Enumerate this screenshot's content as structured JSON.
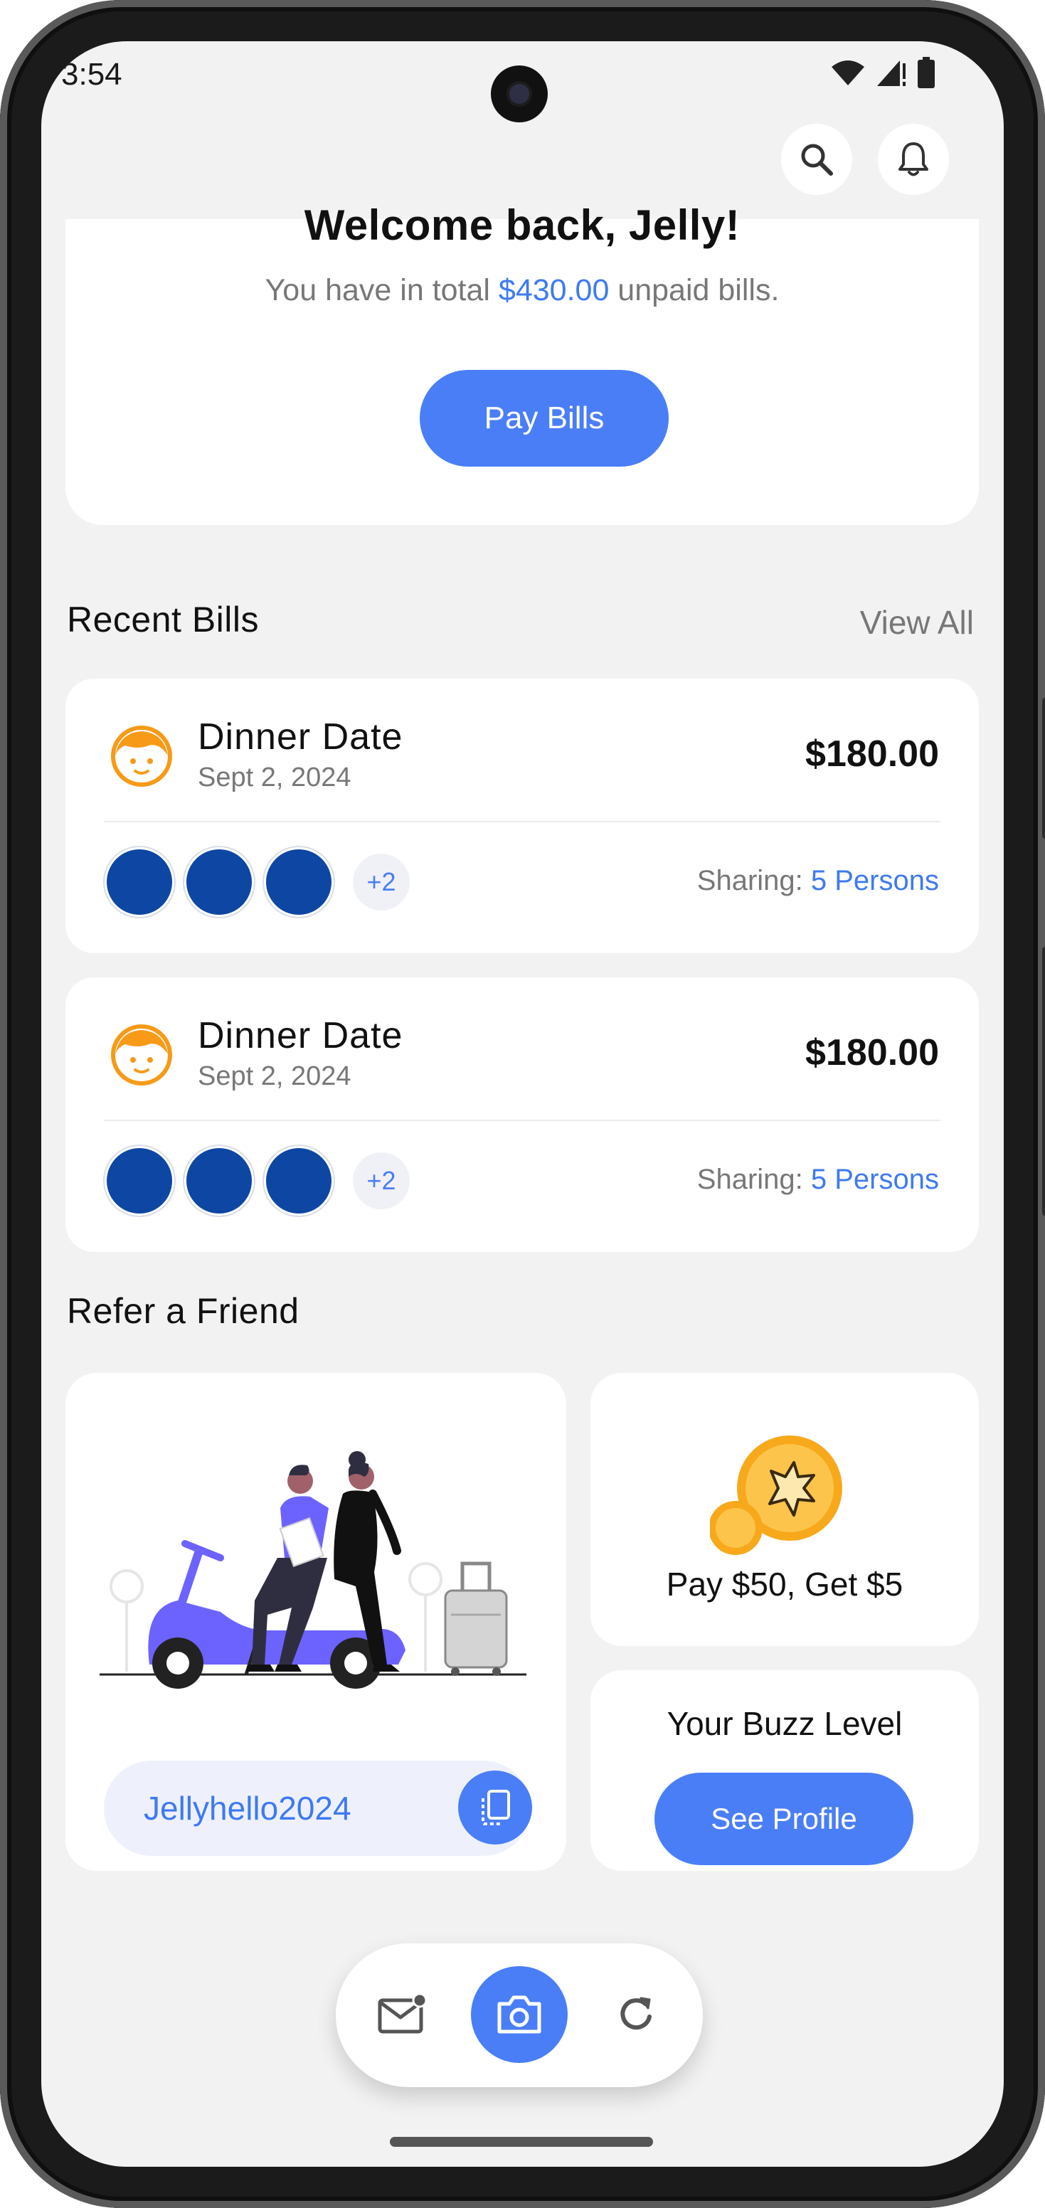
{
  "status_bar": {
    "time": "3:54"
  },
  "header": {
    "search_icon": "search-icon",
    "bell_icon": "bell-icon"
  },
  "welcome": {
    "title": "Welcome back, Jelly!",
    "sub_prefix": "You have in total ",
    "total": "$430.00",
    "sub_suffix": " unpaid bills.",
    "pay_button": "Pay Bills"
  },
  "recent_bills": {
    "title": "Recent Bills",
    "view_all": "View All",
    "items": [
      {
        "name": "Dinner Date",
        "date": "Sept 2, 2024",
        "amount": "$180.00",
        "extra": "+2",
        "sharing_label": "Sharing: ",
        "sharing_value": "5 Persons"
      },
      {
        "name": "Dinner Date",
        "date": "Sept 2, 2024",
        "amount": "$180.00",
        "extra": "+2",
        "sharing_label": "Sharing: ",
        "sharing_value": "5 Persons"
      }
    ]
  },
  "refer": {
    "title": "Refer a Friend",
    "code": "Jellyhello2024",
    "reward": "Pay $50, Get $5",
    "buzz_title": "Your Buzz Level",
    "buzz_button": "See Profile"
  },
  "colors": {
    "accent": "#4a7ef7",
    "avatar_dot": "#0e46a3",
    "avatar_icon": "#f79a17"
  },
  "bottom_nav": {
    "items": [
      "mail-icon",
      "camera-icon",
      "refresh-icon"
    ]
  }
}
